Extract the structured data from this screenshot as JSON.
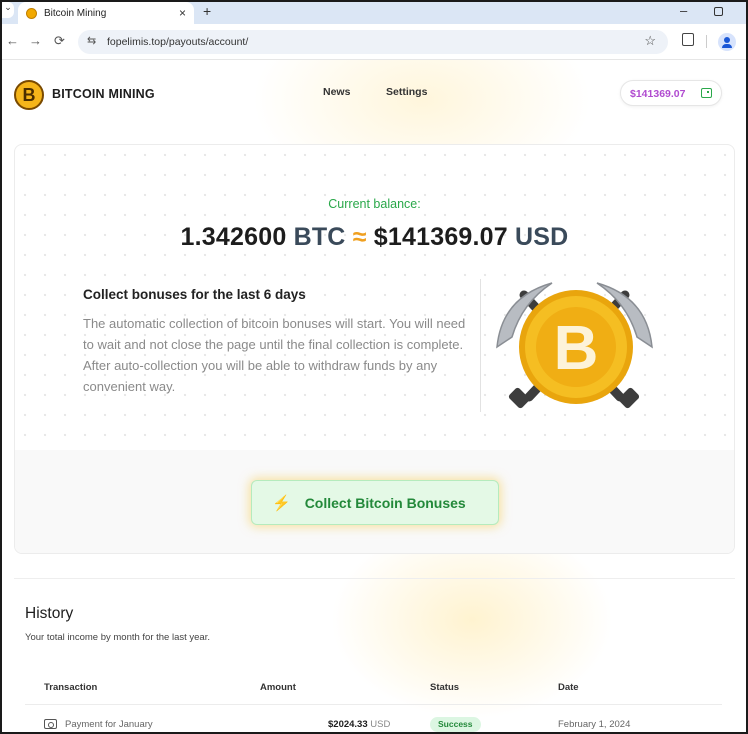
{
  "browser": {
    "tab_title": "Bitcoin Mining",
    "tab_close": "×",
    "new_tab": "+",
    "tab_strip_chevron": "⌄",
    "url": "fopelimis.top/payouts/account/",
    "back": "←",
    "forward": "→",
    "reload": "⟳",
    "site_info": "⇆",
    "bookmark": "☆",
    "window_minimize": "–"
  },
  "header": {
    "logo_glyph": "B",
    "brand": "BITCOIN MINING",
    "nav": [
      {
        "label": "News"
      },
      {
        "label": "Settings"
      }
    ],
    "balance": "$141369.07"
  },
  "hero": {
    "current_balance_label": "Current balance:",
    "btc_amount": "1.342600",
    "btc_unit": "BTC",
    "approx": "≈",
    "usd_amount": "$141369.07",
    "usd_unit": "USD"
  },
  "bonus": {
    "title": "Collect bonuses for the last 6 days",
    "text": "The automatic collection of bitcoin bonuses will start. You will need to wait and not close the page until the final collection is complete. After auto-collection you will be able to withdraw funds by any convenient way.",
    "button_icon": "⚡",
    "button_label": "Collect Bitcoin Bonuses"
  },
  "history": {
    "title": "History",
    "subtitle": "Your total income by month for the last year.",
    "columns": [
      "Transaction",
      "Amount",
      "Status",
      "Date"
    ],
    "rows": [
      {
        "transaction": "Payment for January",
        "amount": "$2024.33",
        "currency": "USD",
        "status": "Success",
        "date": "February 1, 2024"
      }
    ]
  },
  "colors": {
    "accent_green": "#23893a",
    "balance_purple": "#b04bd0",
    "approx_orange": "#f0a020",
    "coin_gold": "#f2b416"
  },
  "icons": {
    "coin_art": "bitcoin-with-pickaxes-icon",
    "payment": "payment-card-icon",
    "wallet": "wallet-icon",
    "bolt": "lightning-icon"
  }
}
